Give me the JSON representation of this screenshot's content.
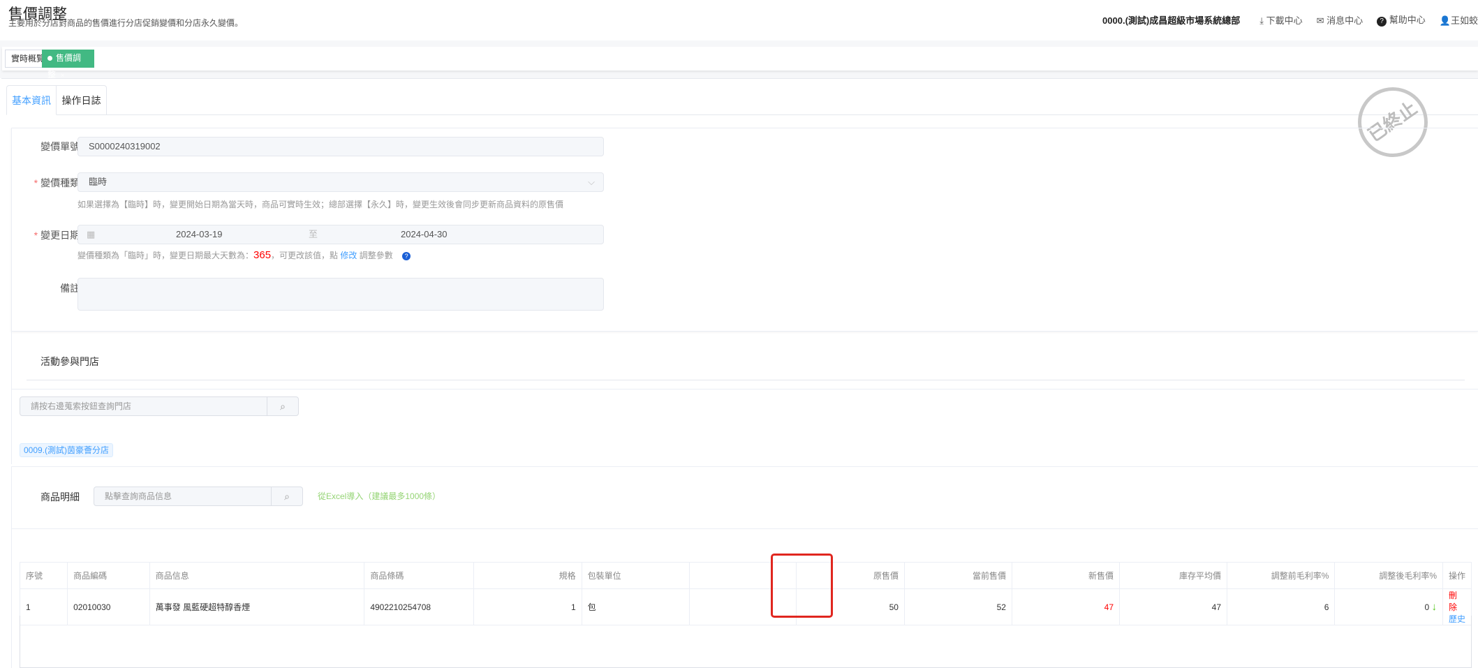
{
  "header": {
    "title": "售價調整",
    "subtitle": "主要用於分店對商品的售價進行分店促銷變價和分店永久變價。",
    "org": "0000.(測試)成昌超級市場系統總部",
    "download": "下載中心",
    "messages": "消息中心",
    "help": "幫助中心",
    "user": "王如蛟"
  },
  "page_tags": {
    "overview": "實時概覽",
    "active": "售價調整",
    "close": "×"
  },
  "tabs": {
    "basic": "基本資訊",
    "log": "操作日誌"
  },
  "stamp": "已終止",
  "form": {
    "order_no_label": "變價單號:",
    "order_no": "S0000240319002",
    "type_label": "變價種類:",
    "type": "臨時",
    "type_hint": "如果選擇為【臨時】時，變更開始日期為當天時，商品可實時生效；總部選擇【永久】時，變更生效後會同步更新商品資料的原售價",
    "date_label": "變更日期:",
    "date_start": "2024-03-19",
    "date_sep": "至",
    "date_end": "2024-04-30",
    "date_hint_1": "變價種類為「臨時」時，變更日期最大天數為：",
    "date_max": "365",
    "date_hint_2": "，可更改該值，點",
    "date_hint_link": "修改",
    "date_hint_3": "調整參數",
    "remark_label": "備註:",
    "required_mark": "*"
  },
  "stores": {
    "title": "活動參與門店",
    "search_placeholder": "請按右邊蒐索按鈕查詢門店",
    "selected": "0009.(測試)茵豪薈分店"
  },
  "goods": {
    "title": "商品明細",
    "search_placeholder": "點擊查詢商品信息",
    "import": "從Excel導入（建議最多1000條）"
  },
  "table": {
    "headers": [
      "序號",
      "商品編碼",
      "商品信息",
      "商品條碼",
      "規格",
      "包裝單位",
      "",
      "原售價",
      "當前售價",
      "新售價",
      "庫存平均價",
      "調整前毛利率%",
      "調整後毛利率%",
      "操作"
    ],
    "rows": [
      {
        "seq": "1",
        "code": "02010030",
        "info": "萬事發 風藍硬超特醇香煙",
        "barcode": "4902210254708",
        "spec": "1",
        "unit": "包",
        "blank": "",
        "orig": "50",
        "current": "52",
        "new": "47",
        "avg": "47",
        "before": "6",
        "after": "0",
        "delete": "刪除",
        "history": "歷史"
      }
    ]
  },
  "colors": {
    "accent": "#409eff",
    "active_tag": "#42b983",
    "danger": "#f56c6c",
    "highlight": "#e0261f"
  }
}
